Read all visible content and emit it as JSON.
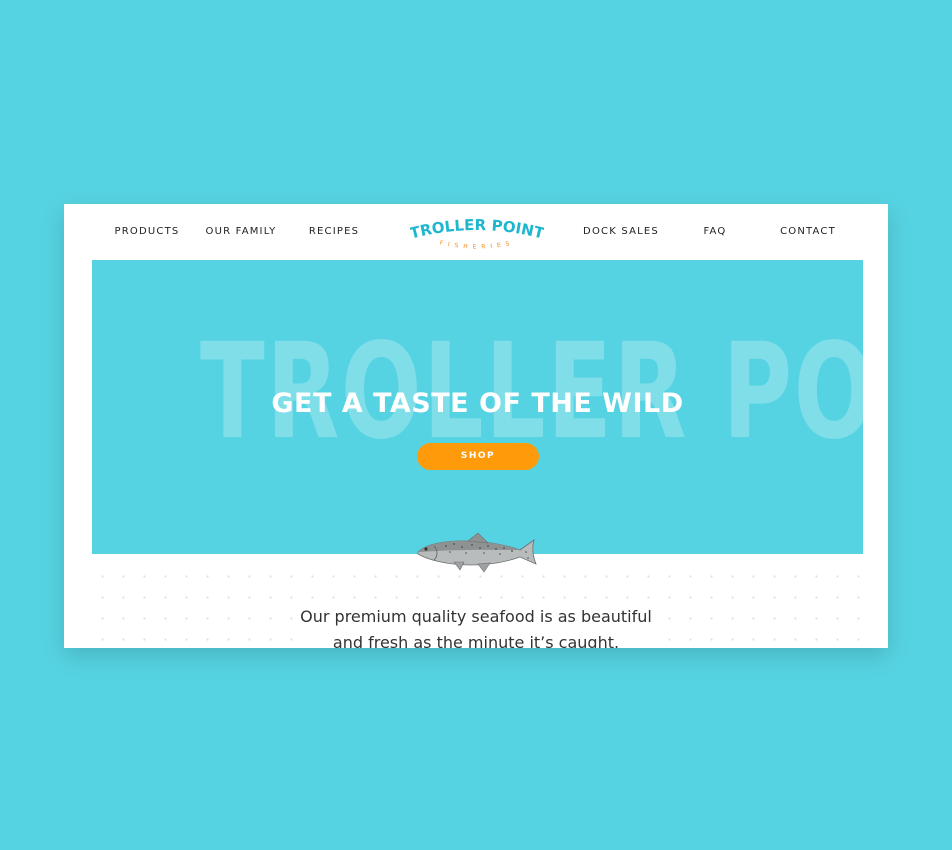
{
  "nav": {
    "left": [
      "PRODUCTS",
      "OUR FAMILY",
      "RECIPES"
    ],
    "right": [
      "DOCK SALES",
      "FAQ",
      "CONTACT"
    ]
  },
  "logo": {
    "name": "TROLLER POINT",
    "sub": "FISHERIES"
  },
  "hero": {
    "background_word": "TROLLER POINT",
    "headline": "GET A TASTE OF THE WILD",
    "shop_label": "SHOP"
  },
  "intro": {
    "line1": "Our premium quality seafood is as beautiful",
    "line2": "and fresh as the minute it’s caught."
  },
  "colors": {
    "page_bg": "#56d3e2",
    "accent_orange": "#ff9b0a",
    "logo_blue": "#1fb6cf",
    "logo_orange": "#f08a1c"
  },
  "icons": {
    "fish": "salmon-illustration"
  }
}
